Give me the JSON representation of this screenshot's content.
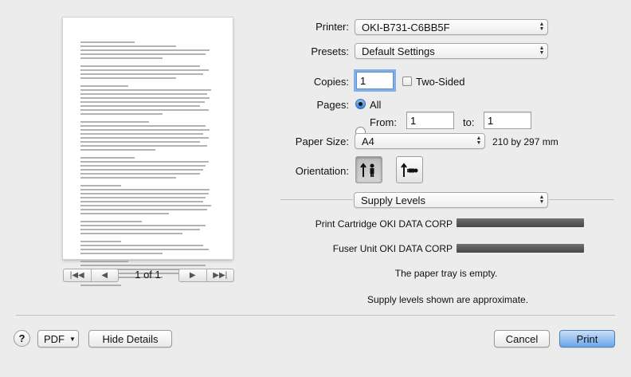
{
  "preview": {
    "page_indicator": "1 of 1"
  },
  "printer": {
    "label": "Printer:",
    "value": "OKI-B731-C6BB5F"
  },
  "presets": {
    "label": "Presets:",
    "value": "Default Settings"
  },
  "copies": {
    "label": "Copies:",
    "value": "1",
    "two_sided_label": "Two-Sided"
  },
  "pages": {
    "label": "Pages:",
    "all_label": "All",
    "from_label": "From:",
    "from_value": "1",
    "to_label": "to:",
    "to_value": "1"
  },
  "paper_size": {
    "label": "Paper Size:",
    "value": "A4",
    "dimensions": "210 by 297 mm"
  },
  "orientation": {
    "label": "Orientation:",
    "selected": "portrait"
  },
  "section": {
    "value": "Supply Levels"
  },
  "supplies": [
    {
      "label": "Print Cartridge OKI DATA CORP",
      "level": 1.0
    },
    {
      "label": "Fuser Unit OKI DATA CORP",
      "level": 1.0
    }
  ],
  "messages": {
    "tray": "The paper tray is empty.",
    "approx": "Supply levels shown are approximate."
  },
  "footer": {
    "help": "?",
    "pdf": "PDF",
    "hide_details": "Hide Details",
    "cancel": "Cancel",
    "print": "Print"
  },
  "colors": {
    "accent": "#6aa6ea",
    "focus": "#7fb1e8"
  }
}
